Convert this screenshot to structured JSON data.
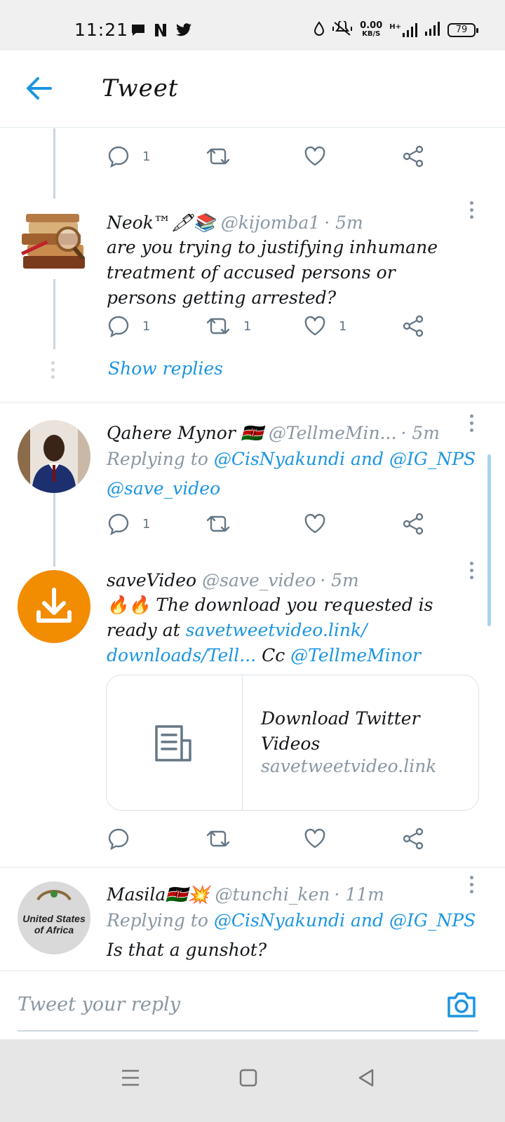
{
  "status_bar": {
    "time": "11:21",
    "network_speed": "0.00",
    "network_unit": "KB/S",
    "network_type": "H+",
    "battery": "79"
  },
  "app_bar": {
    "title": "Tweet",
    "accent_color": "#1b95e0"
  },
  "thread": {
    "top_actions": {
      "reply_count": "1"
    },
    "tweets": [
      {
        "name": "Neok™🖋📚",
        "handle": "@kijomba1",
        "time": "· 5m",
        "text": "are you trying to justifying inhumane treatment of accused persons or persons getting arrested?",
        "reply_count": "1",
        "retweet_count": "1",
        "like_count": "1",
        "show_replies": "Show replies"
      },
      {
        "name": "Qahere Mynor 🇰🇪",
        "handle": "@TellmeMin...",
        "time": "· 5m",
        "replying_prefix": "Replying to",
        "replying_user1": "@CisNyakundi",
        "replying_and": "and",
        "replying_user2": "@IG_NPS",
        "mention": "@save_video",
        "reply_count": "1"
      },
      {
        "name": "saveVideo",
        "handle": "@save_video",
        "time": "· 5m",
        "emoji": "🔥🔥",
        "text_before": "The download you requested is ready at",
        "link1": "savetweetvideo.link/",
        "link2": "downloads/Tell...",
        "cc": "Cc",
        "cc_user": "@TellmeMinor",
        "card_title": "Download Twitter Videos",
        "card_domain": "savetweetvideo.link",
        "avatar_color": "#f28c00"
      },
      {
        "name": "Masila🇰🇪💥",
        "handle": "@tunchi_ken",
        "time": "· 11m",
        "replying_prefix": "Replying to",
        "replying_user1": "@CisNyakundi",
        "replying_and": "and",
        "replying_user2": "@IG_NPS",
        "text": "Is that a gunshot?",
        "avatar_text_line1": "United States",
        "avatar_text_line2": "of Africa"
      }
    ]
  },
  "reply_bar": {
    "placeholder": "Tweet your reply"
  }
}
